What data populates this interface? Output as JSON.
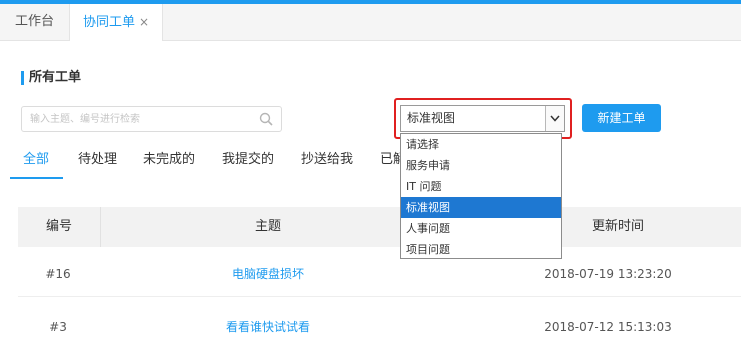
{
  "tabs": [
    {
      "label": "工作台"
    },
    {
      "label": "协同工单",
      "close": "×"
    }
  ],
  "section_title": "所有工单",
  "search": {
    "placeholder": "输入主题、编号进行检索"
  },
  "view_select": {
    "value": "标准视图",
    "options": [
      "请选择",
      "服务申请",
      "IT 问题",
      "标准视图",
      "人事问题",
      "项目问题"
    ]
  },
  "new_button": "新建工单",
  "filter_tabs": [
    "全部",
    "待处理",
    "未完成的",
    "我提交的",
    "抄送给我",
    "已解决的"
  ],
  "table": {
    "headers": [
      "编号",
      "主题",
      "更新时间"
    ],
    "rows": [
      {
        "id": "#16",
        "subject": "电脑硬盘损坏",
        "updated": "2018-07-19 13:23:20"
      },
      {
        "id": "#3",
        "subject": "看看谁快试试看",
        "updated": "2018-07-12 15:13:03"
      }
    ]
  },
  "colors": {
    "accent": "#1e9bef",
    "highlight_border": "#e02020",
    "option_selected": "#1e78d2"
  }
}
